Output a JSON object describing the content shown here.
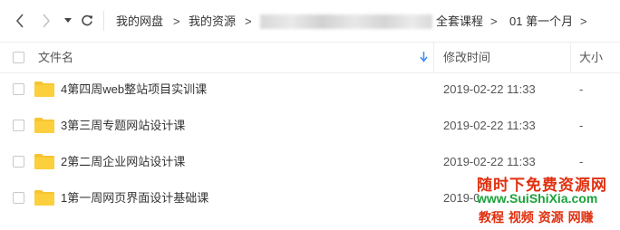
{
  "nav": {
    "breadcrumbs": [
      "我的网盘",
      "我的资源",
      "全套课程",
      "01 第一个月"
    ],
    "separator": ">",
    "trailing_separator": ">"
  },
  "table": {
    "columns": {
      "name": "文件名",
      "modified": "修改时间",
      "size": "大小"
    },
    "rows": [
      {
        "name": "4第四周web整站项目实训课",
        "modified": "2019-02-22 11:33",
        "size": "-"
      },
      {
        "name": "3第三周专题网站设计课",
        "modified": "2019-02-22 11:33",
        "size": "-"
      },
      {
        "name": "2第二周企业网站设计课",
        "modified": "2019-02-22 11:33",
        "size": "-"
      },
      {
        "name": "1第一周网页界面设计基础课",
        "modified": "2019-0",
        "size": ""
      }
    ]
  },
  "watermark": {
    "line1": "随时下免费资源网",
    "line2": "www.SuiShiXia.com",
    "line3": "教程 视频 资源 网赚"
  },
  "colors": {
    "folder": "#f7c531",
    "sort_arrow": "#3c8cf5",
    "watermark_red": "#e03010",
    "watermark_green": "#1aa33a"
  },
  "icons": {
    "back": "chevron-left-icon",
    "forward": "chevron-right-icon",
    "history": "caret-down-icon",
    "refresh": "refresh-icon",
    "sort": "arrow-down-icon",
    "folder": "folder-icon"
  }
}
